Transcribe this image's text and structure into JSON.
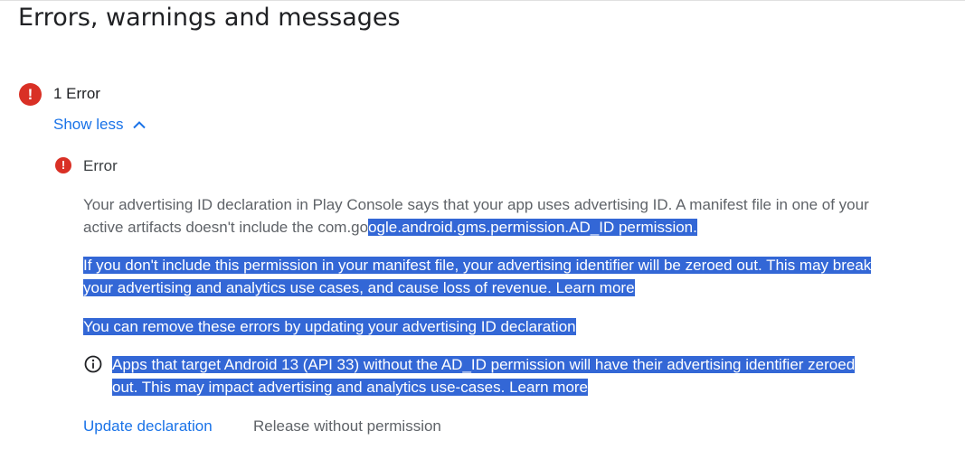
{
  "page": {
    "title": "Errors, warnings and messages"
  },
  "summary": {
    "icon": "error-icon",
    "label": "1 Error",
    "toggle_label": "Show less",
    "toggle_icon": "chevron-up-icon"
  },
  "error": {
    "icon": "error-icon",
    "title": "Error",
    "description": {
      "line1": "Your advertising ID declaration in Play Console says that your app uses advertising ID. A manifest file in one of your",
      "line2_plain": "active artifacts doesn't include the com.go",
      "line2_selected": "ogle.android.gms.permission.AD_ID permission."
    },
    "consequence": {
      "line1": "If you don't include this permission in your manifest file, your advertising identifier will be zeroed out. This may break",
      "line2": "your advertising and analytics use cases, and cause loss of revenue.",
      "link": "Learn more"
    },
    "remedy": "You can remove these errors by updating your advertising ID declaration",
    "info": {
      "icon": "info-icon",
      "line1": "Apps that target Android 13 (API 33) without the AD_ID permission will have their advertising identifier zeroed",
      "line2": "out. This may impact advertising and analytics use-cases.",
      "link": "Learn more"
    }
  },
  "actions": {
    "update_label": "Update declaration",
    "release_label": "Release without permission"
  },
  "colors": {
    "error_red": "#d93025",
    "link_blue": "#1a73e8",
    "selection": "#3367d6"
  }
}
